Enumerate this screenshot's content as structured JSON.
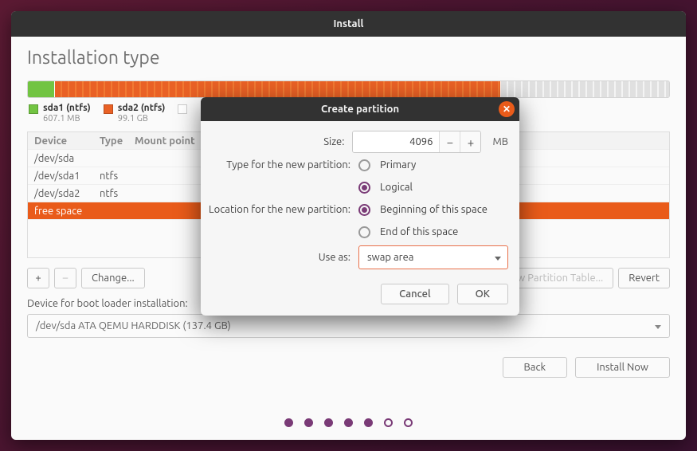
{
  "window": {
    "title": "Install"
  },
  "page": {
    "title": "Installation type"
  },
  "legend": [
    {
      "swatch": "green",
      "name": "sda1 (ntfs)",
      "sub": "607.1 MB"
    },
    {
      "swatch": "orange",
      "name": "sda2 (ntfs)",
      "sub": "99.1 GB"
    },
    {
      "swatch": "white",
      "name": "",
      "sub": ""
    }
  ],
  "table": {
    "headers": {
      "device": "Device",
      "type": "Type",
      "mount": "Mount point"
    },
    "rows": [
      {
        "device": "/dev/sda",
        "type": "",
        "mount": "",
        "selected": false
      },
      {
        "device": "/dev/sda1",
        "type": "ntfs",
        "mount": "",
        "selected": false
      },
      {
        "device": "/dev/sda2",
        "type": "ntfs",
        "mount": "",
        "selected": false
      },
      {
        "device": "free space",
        "type": "",
        "mount": "",
        "selected": true
      }
    ]
  },
  "toolbar": {
    "add": "+",
    "remove": "–",
    "change": "Change...",
    "newtable": "New Partition Table...",
    "revert": "Revert"
  },
  "boot": {
    "label": "Device for boot loader installation:",
    "value": "/dev/sda   ATA QEMU HARDDISK (137.4 GB)"
  },
  "nav": {
    "back": "Back",
    "install": "Install Now"
  },
  "dialog": {
    "title": "Create partition",
    "size": {
      "label": "Size:",
      "value": "4096",
      "unit": "MB"
    },
    "type": {
      "label": "Type for the new partition:",
      "primary": "Primary",
      "logical": "Logical",
      "selected": "logical"
    },
    "location": {
      "label": "Location for the new partition:",
      "begin": "Beginning of this space",
      "end": "End of this space",
      "selected": "begin"
    },
    "useas": {
      "label": "Use as:",
      "value": "swap area"
    },
    "actions": {
      "cancel": "Cancel",
      "ok": "OK"
    }
  }
}
